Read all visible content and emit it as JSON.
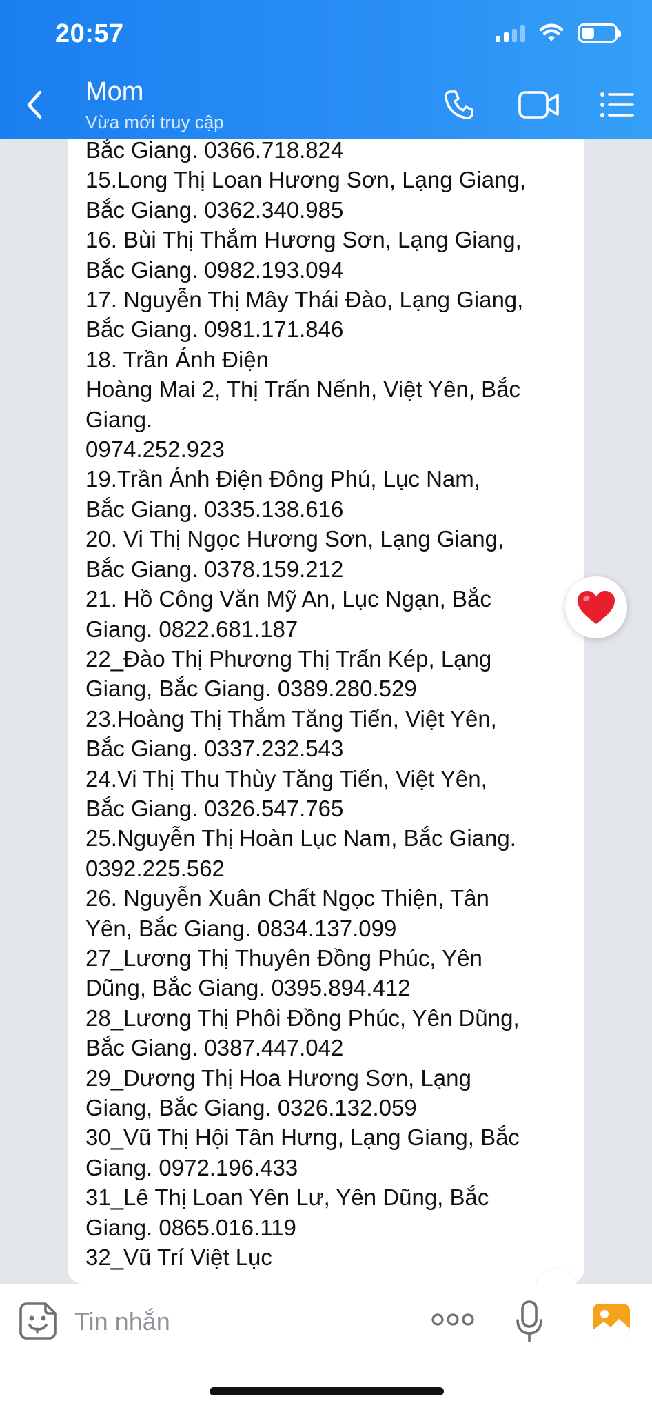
{
  "status_bar": {
    "time": "20:57"
  },
  "header": {
    "contact_name": "Mom",
    "contact_status": "Vừa mới truy cập"
  },
  "message": {
    "text": "Bắc Giang. 0366.718.824\n15.Long Thị Loan Hương Sơn, Lạng Giang,\nBắc Giang. 0362.340.985\n16. Bùi Thị Thắm Hương Sơn, Lạng Giang,\nBắc Giang. 0982.193.094\n17. Nguyễn Thị Mây Thái Đào, Lạng Giang,\nBắc Giang. 0981.171.846\n18. Trần Ánh Điện\nHoàng Mai 2, Thị Trấn Nếnh, Việt Yên, Bắc\nGiang.\n0974.252.923\n19.Trần Ánh Điện Đông Phú, Lục Nam,\nBắc Giang. 0335.138.616\n20. Vi Thị Ngọc Hương Sơn, Lạng Giang,\nBắc Giang. 0378.159.212\n21. Hồ Công Văn Mỹ An, Lục Ngạn, Bắc\nGiang. 0822.681.187\n22_Đào Thị Phương Thị Trấn Kép, Lạng\nGiang, Bắc Giang. 0389.280.529\n23.Hoàng Thị Thắm Tăng Tiến, Việt Yên,\nBắc Giang. 0337.232.543\n24.Vi Thị Thu Thùy Tăng Tiến, Việt Yên,\nBắc Giang. 0326.547.765\n25.Nguyễn Thị Hoàn Lục Nam, Bắc Giang.\n0392.225.562\n26. Nguyễn Xuân Chất Ngọc Thiện, Tân\nYên, Bắc Giang. 0834.137.099\n27_Lương Thị Thuyên Đồng Phúc, Yên\nDũng, Bắc Giang. 0395.894.412\n28_Lương Thị Phôi Đồng Phúc, Yên Dũng,\nBắc Giang. 0387.447.042\n29_Dương Thị Hoa Hương Sơn, Lạng\nGiang, Bắc Giang. 0326.132.059\n30_Vũ Thị Hội Tân Hưng, Lạng Giang, Bắc\nGiang. 0972.196.433\n31_Lê Thị Loan Yên Lư, Yên Dũng, Bắc\nGiang. 0865.016.119\n32_Vũ Trí Việt Lục"
  },
  "input_bar": {
    "placeholder": "Tin nhắn"
  },
  "icons": {
    "back": "chevron-left-icon",
    "call": "phone-icon",
    "video": "video-camera-icon",
    "menu": "list-menu-icon",
    "reaction": "heart-icon",
    "emoji": "sticker-face-icon",
    "more": "more-dots-icon",
    "mic": "microphone-icon",
    "photo": "image-icon"
  },
  "colors": {
    "header_start": "#1a7ff0",
    "header_end": "#35a0f7",
    "heart": "#e8202e",
    "photo_icon": "#f7a21b"
  }
}
